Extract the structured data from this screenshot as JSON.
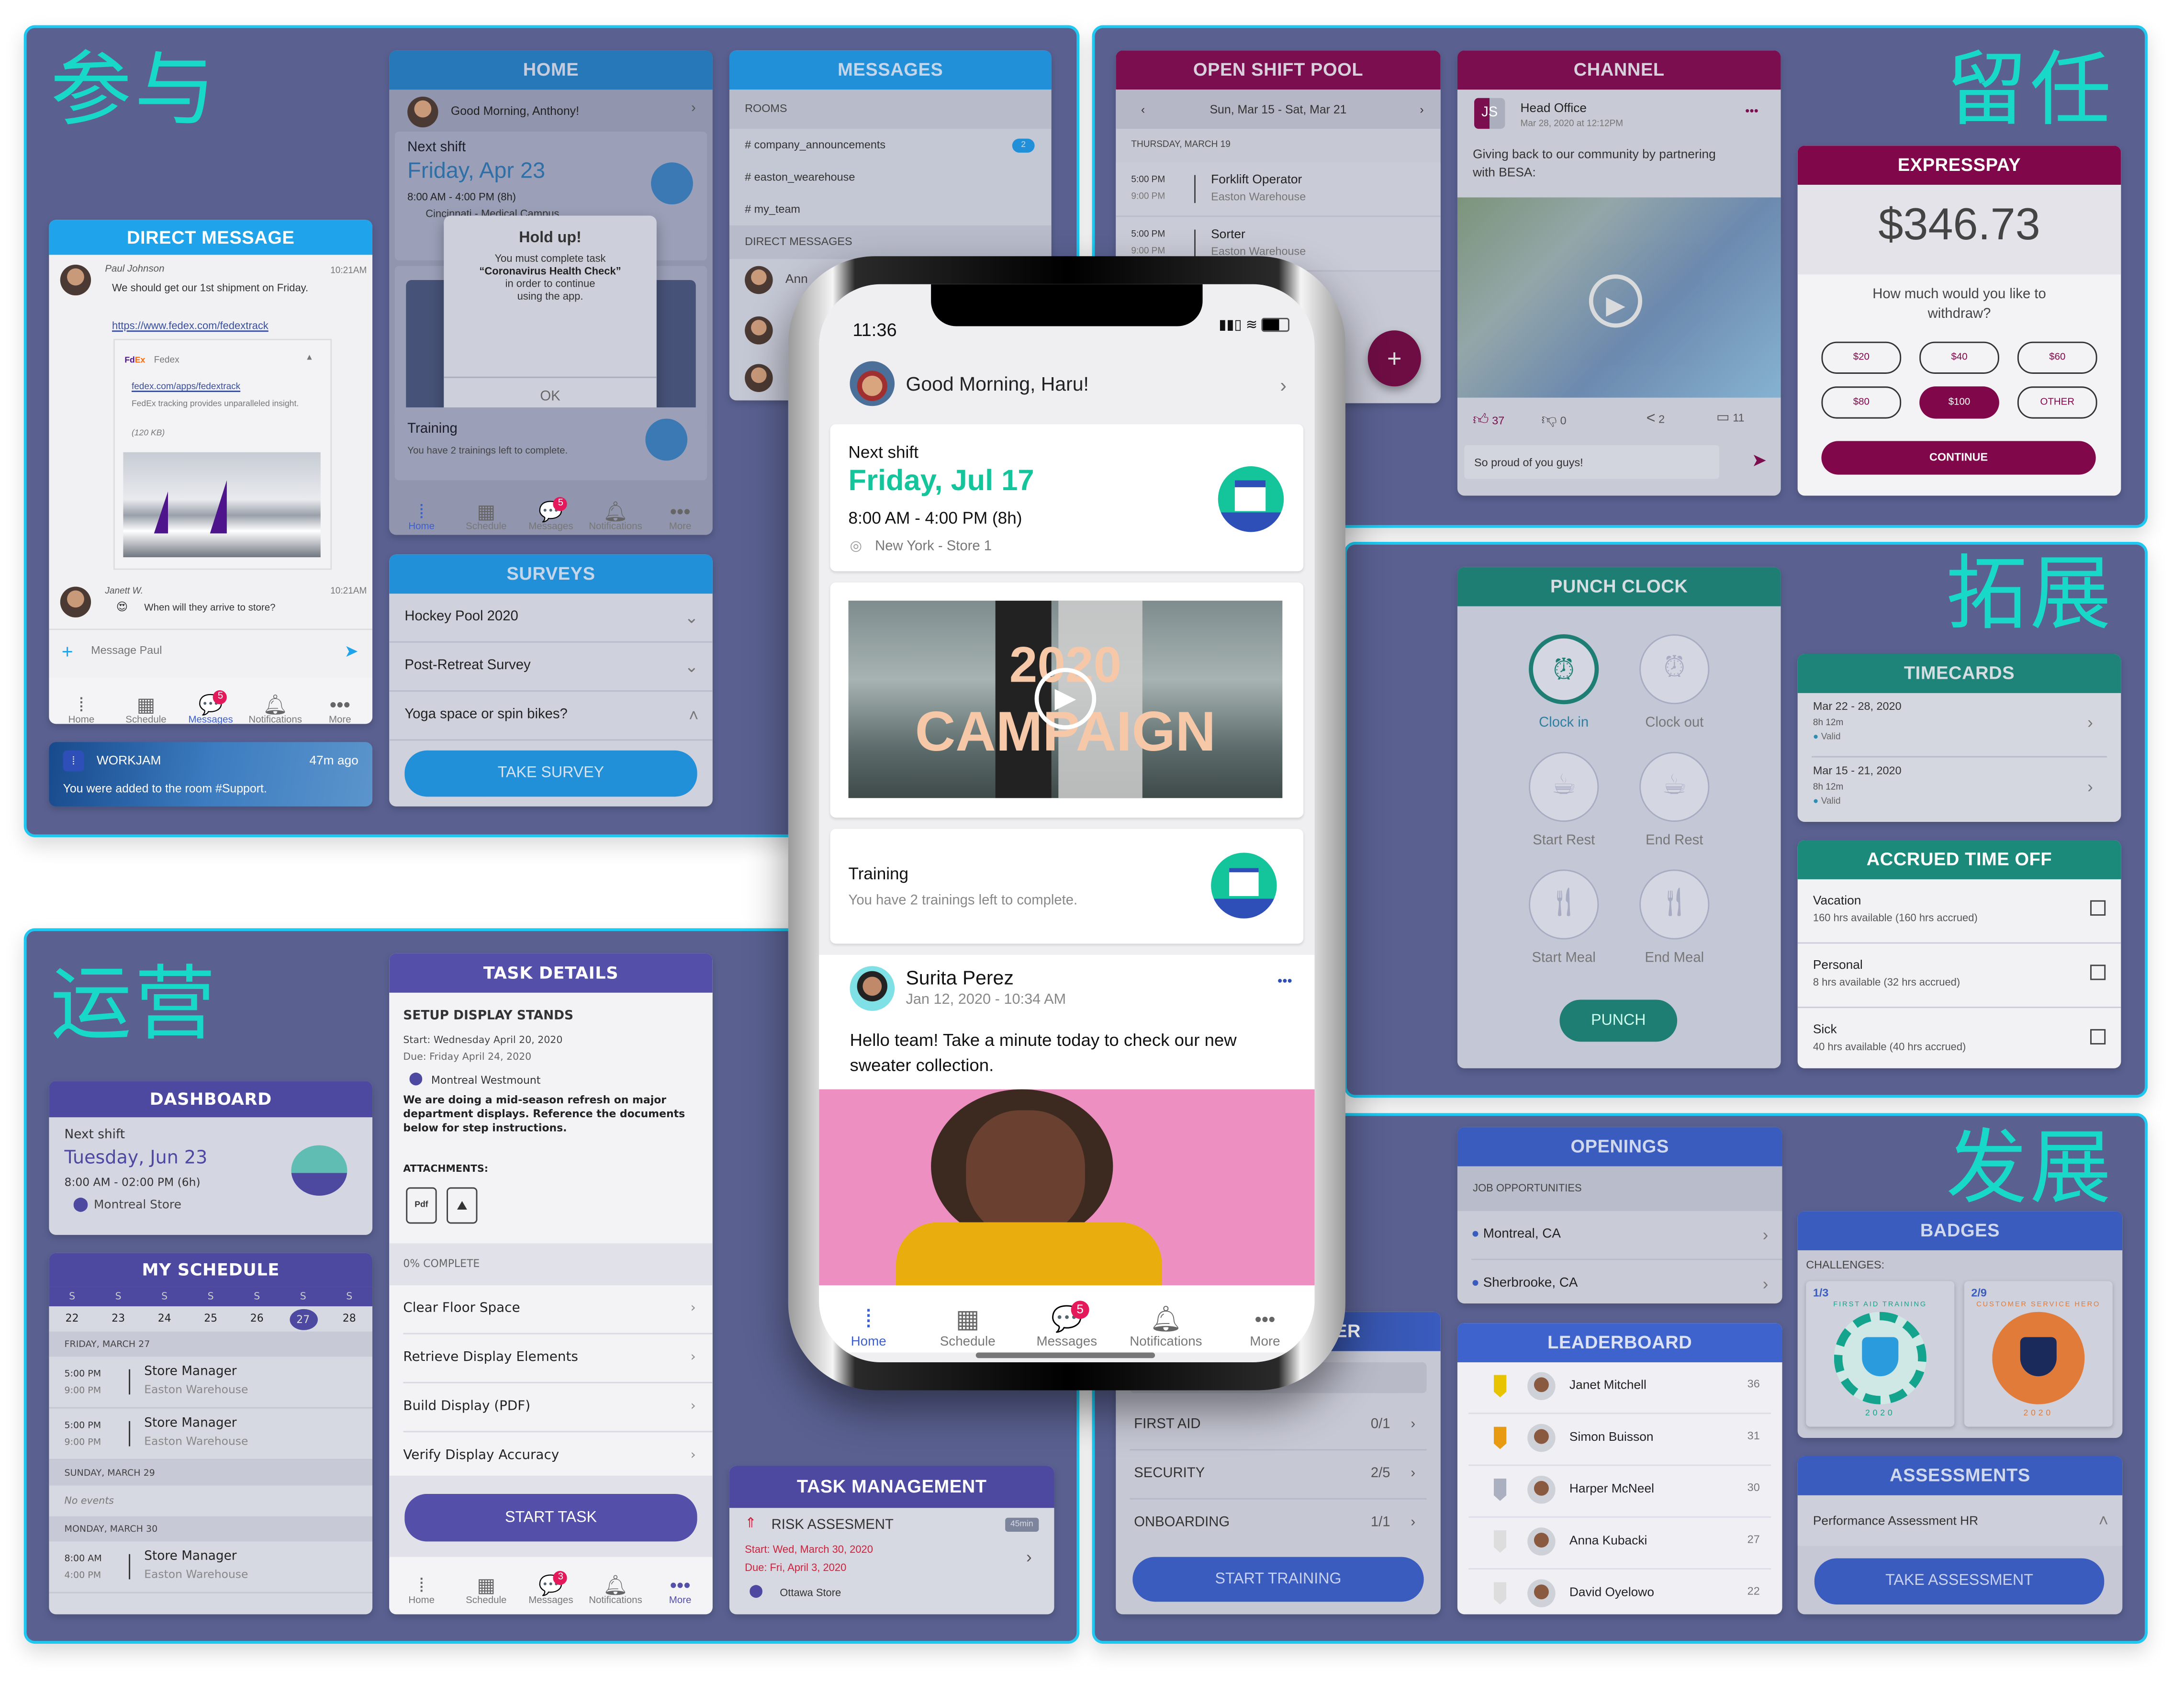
{
  "sections": {
    "engage": "参与",
    "retain": "留任",
    "expand": "拓展",
    "operate": "运营",
    "develop": "发展"
  },
  "home_panel": {
    "title": "HOME",
    "greeting": "Good Morning, Anthony!",
    "next_shift_label": "Next shift",
    "next_shift_date": "Friday, Apr 23",
    "next_shift_time": "8:00 AM - 4:00 PM (8h)",
    "next_shift_location": "Cincinnati - Medical Campus",
    "dialog": {
      "title": "Hold up!",
      "line1": "You must complete task",
      "task": "“Coronavirus Health Check”",
      "line2": "in order to continue",
      "line3": "using the app.",
      "ok": "OK"
    },
    "training_title": "Training",
    "training_text": "You have 2 trainings left to complete.",
    "nav": [
      {
        "label": "Home",
        "icon": "home-icon",
        "active": true
      },
      {
        "label": "Schedule",
        "icon": "calendar-icon"
      },
      {
        "label": "Messages",
        "icon": "chat-icon",
        "badge": "5"
      },
      {
        "label": "Notifications",
        "icon": "bell-icon"
      },
      {
        "label": "More",
        "icon": "more-icon"
      }
    ]
  },
  "direct_message": {
    "title": "DIRECT MESSAGE",
    "msg1": {
      "author": "Paul Johnson",
      "time": "10:21AM",
      "text": "We should get our 1st shipment on Friday.",
      "link": "https://www.fedex.com/fedextrack",
      "preview_brand": "Fedex",
      "preview_link": "fedex.com/apps/fedextrack",
      "preview_desc": "FedEx tracking provides unparalleled insight.",
      "preview_size": "(120 KB)"
    },
    "msg2": {
      "author": "Janett W.",
      "time": "10:21AM",
      "text": "When will they arrive to store?"
    },
    "input_placeholder": "Message Paul",
    "nav": [
      {
        "label": "Home"
      },
      {
        "label": "Schedule"
      },
      {
        "label": "Messages",
        "badge": "5",
        "active": true
      },
      {
        "label": "Notifications"
      },
      {
        "label": "More"
      }
    ]
  },
  "notification": {
    "app": "WORKJAM",
    "time": "47m ago",
    "text": "You were added to the room #Support."
  },
  "messages_panel": {
    "title": "MESSAGES",
    "rooms_label": "ROOMS",
    "rooms": [
      {
        "name": "# company_announcements",
        "badge": "2"
      },
      {
        "name": "# easton_wearehouse"
      },
      {
        "name": "# my_team"
      }
    ],
    "dm_label": "DIRECT MESSAGES",
    "dms": [
      {
        "name": "Ann"
      },
      {
        "name": ""
      },
      {
        "name": ""
      }
    ]
  },
  "surveys": {
    "title": "SURVEYS",
    "items": [
      {
        "label": "Hockey Pool 2020",
        "chevron": "v"
      },
      {
        "label": "Post-Retreat Survey",
        "chevron": "v"
      },
      {
        "label": "Yoga space or spin bikes?",
        "chevron": "^"
      }
    ],
    "button": "TAKE SURVEY"
  },
  "open_shift_pool": {
    "title": "OPEN SHIFT POOL",
    "week": "Sun, Mar 15 - Sat, Mar 21",
    "day": "THURSDAY, MARCH 19",
    "shifts": [
      {
        "start": "5:00 PM",
        "end": "9:00 PM",
        "role": "Forklift Operator",
        "location": "Easton Warehouse"
      },
      {
        "start": "5:00 PM",
        "end": "9:00 PM",
        "role": "Sorter",
        "location": "Easton Warehouse"
      }
    ],
    "fab": "+"
  },
  "channel": {
    "title": "CHANNEL",
    "author": "Head Office",
    "date": "Mar 28, 2020 at 12:12PM",
    "text": "Giving back to our community by partnering with BESA:",
    "likes": "37",
    "dislikes": "0",
    "shares": "2",
    "comments": "11",
    "input_value": "So proud of you guys!"
  },
  "expresspay": {
    "title": "EXPRESSPAY",
    "amount": "$346.73",
    "question": "How much would you like to withdraw?",
    "options": [
      "$20",
      "$40",
      "$60",
      "$80",
      "$100",
      "OTHER"
    ],
    "selected": "$100",
    "button": "CONTINUE"
  },
  "phone": {
    "time": "11:36",
    "greeting": "Good Morning, Haru!",
    "next_shift_label": "Next shift",
    "next_shift_date": "Friday, Jul 17",
    "next_shift_time": "8:00 AM - 4:00 PM (8h)",
    "next_shift_location": "New York - Store 1",
    "video_title_line1": "2020",
    "video_title_line2": "CAMPAIGN",
    "training_title": "Training",
    "training_text": "You have 2 trainings left to complete.",
    "post": {
      "author": "Surita Perez",
      "date": "Jan 12, 2020 - 10:34 AM",
      "text": "Hello team! Take a minute today to check our new sweater collection."
    },
    "nav": [
      {
        "label": "Home",
        "active": true
      },
      {
        "label": "Schedule"
      },
      {
        "label": "Messages",
        "badge": "5"
      },
      {
        "label": "Notifications"
      },
      {
        "label": "More"
      }
    ]
  },
  "punch_clock": {
    "title": "PUNCH CLOCK",
    "actions": [
      {
        "label": "Clock in",
        "icon": "alarm-clock-icon",
        "active": true
      },
      {
        "label": "Clock out",
        "icon": "alarm-clock-icon"
      },
      {
        "label": "Start Rest",
        "icon": "coffee-cup-icon"
      },
      {
        "label": "End Rest",
        "icon": "coffee-cup-icon"
      },
      {
        "label": "Start Meal",
        "icon": "fork-knife-icon"
      },
      {
        "label": "End Meal",
        "icon": "fork-knife-icon"
      }
    ],
    "button": "PUNCH"
  },
  "timecards": {
    "title": "TIMECARDS",
    "items": [
      {
        "range": "Mar 22 - 28, 2020",
        "hours": "8h 12m",
        "status": "Valid"
      },
      {
        "range": "Mar 15 - 21, 2020",
        "hours": "8h 12m",
        "status": "Valid"
      }
    ]
  },
  "accrued": {
    "title": "ACCRUED TIME OFF",
    "items": [
      {
        "type": "Vacation",
        "detail": "160 hrs available (160 hrs accrued)"
      },
      {
        "type": "Personal",
        "detail": "8 hrs available (32 hrs accrued)"
      },
      {
        "type": "Sick",
        "detail": "40 hrs available (40 hrs accrued)"
      }
    ]
  },
  "dashboard": {
    "title": "DASHBOARD",
    "next_shift_label": "Next shift",
    "date": "Tuesday, Jun 23",
    "time": "8:00 AM - 02:00 PM (6h)",
    "location": "Montreal Store"
  },
  "my_schedule": {
    "title": "MY SCHEDULE",
    "weekdays": [
      "S",
      "S",
      "S",
      "S",
      "S",
      "S",
      "S"
    ],
    "dates": [
      "22",
      "23",
      "24",
      "25",
      "26",
      "27",
      "28"
    ],
    "selected": "27",
    "groups": [
      {
        "day": "FRIDAY, MARCH 27",
        "events": [
          {
            "start": "5:00 PM",
            "end": "9:00 PM",
            "role": "Store Manager",
            "location": "Easton Warehouse"
          },
          {
            "start": "5:00 PM",
            "end": "9:00 PM",
            "role": "Store Manager",
            "location": "Easton Warehouse"
          }
        ]
      },
      {
        "day": "SUNDAY, MARCH 29",
        "empty": "No events"
      },
      {
        "day": "MONDAY, MARCH 30",
        "events": [
          {
            "start": "8:00 AM",
            "end": "4:00 PM",
            "role": "Store Manager",
            "location": "Easton Warehouse"
          }
        ]
      }
    ]
  },
  "task_details": {
    "title": "TASK DETAILS",
    "task": "SETUP DISPLAY STANDS",
    "start": "Start: Wednesday April 20, 2020",
    "due": "Due: Friday April 24, 2020",
    "location": "Montreal Westmount",
    "description": "We are doing a mid-season refresh on major department displays. Reference the documents below for step instructions.",
    "attachments_label": "ATTACHMENTS:",
    "attachments": [
      "Pdf",
      "image"
    ],
    "progress_label": "0% COMPLETE",
    "progress": 0,
    "steps": [
      "Clear Floor Space",
      "Retrieve Display Elements",
      "Build Display (PDF)",
      "Verify Display Accuracy"
    ],
    "button": "START TASK",
    "nav": [
      {
        "label": "Home"
      },
      {
        "label": "Schedule"
      },
      {
        "label": "Messages",
        "badge": "3"
      },
      {
        "label": "Notifications"
      },
      {
        "label": "More",
        "active": true
      }
    ]
  },
  "task_management": {
    "title": "TASK MANAGEMENT",
    "task": "RISK ASSESMENT",
    "duration": "45min",
    "start": "Start: Wed, March 30, 2020",
    "due": "Due: Fri, April 3, 2020",
    "location": "Ottawa Store"
  },
  "training_panel": {
    "title_fragment": "ER",
    "items": [
      {
        "label": "FIRST AID",
        "progress": "0/1"
      },
      {
        "label": "SECURITY",
        "progress": "2/5"
      },
      {
        "label": "ONBOARDING",
        "progress": "1/1"
      }
    ],
    "button": "START TRAINING"
  },
  "openings": {
    "title": "OPENINGS",
    "subtitle": "JOB OPPORTUNITIES",
    "items": [
      "Montreal, CA",
      "Sherbrooke, CA"
    ]
  },
  "leaderboard": {
    "title": "LEADERBOARD",
    "items": [
      {
        "name": "Janet Mitchell",
        "score": "36",
        "medal": "#e8c400"
      },
      {
        "name": "Simon Buisson",
        "score": "31",
        "medal": "#e89a10"
      },
      {
        "name": "Harper McNeel",
        "score": "30",
        "medal": "#aab0c0"
      },
      {
        "name": "Anna Kubacki",
        "score": "27",
        "medal": "#dddddd"
      },
      {
        "name": "David Oyelowo",
        "score": "22",
        "medal": "#dddddd"
      }
    ]
  },
  "badges": {
    "title": "BADGES",
    "challenges_label": "CHALLENGES:",
    "items": [
      {
        "progress": "1/3",
        "name": "FIRST AID TRAINING",
        "year": "2020"
      },
      {
        "progress": "2/9",
        "name": "CUSTOMER SERVICE HERO",
        "year": "2020"
      }
    ]
  },
  "assessments": {
    "title": "ASSESSMENTS",
    "item": "Performance Assessment HR",
    "button": "TAKE ASSESSMENT"
  }
}
